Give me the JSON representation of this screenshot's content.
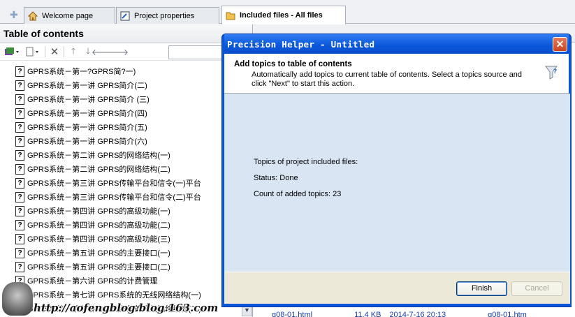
{
  "tabs": [
    {
      "label": "Welcome page",
      "icon": "home-icon"
    },
    {
      "label": "Project properties",
      "icon": "properties-icon"
    },
    {
      "label": "Included files - All files",
      "icon": "folder-icon"
    }
  ],
  "left_pane": {
    "title": "Table of contents",
    "toolbar_icons": [
      "add-topic-icon",
      "page-icon",
      "delete-icon",
      "move-up-icon",
      "move-down-icon",
      "move-left-icon",
      "move-right-icon"
    ],
    "items": [
      "GPRS系统－第一?GPRS简?一)",
      "GPRS系统－第一讲 GPRS简介(二)",
      "GPRS系统－第一讲 GPRS简介 (三)",
      "GPRS系统－第一讲 GPRS简介(四)",
      "GPRS系统－第一讲 GPRS简介(五)",
      "GPRS系统－第一讲 GPRS简介(六)",
      "GPRS系统－第二讲 GPRS的网络结构(一)",
      "GPRS系统－第二讲 GPRS的网络结构(二)",
      "GPRS系统－第三讲 GPRS传输平台和信令(一)平台",
      "GPRS系统－第三讲 GPRS传输平台和信令(二)平台",
      "GPRS系统－第四讲 GPRS的高级功能(一)",
      "GPRS系统－第四讲 GPRS的高级功能(二)",
      "GPRS系统－第四讲 GPRS的高级功能(三)",
      "GPRS系统－第五讲 GPRS的主要接口(一)",
      "GPRS系统－第五讲 GPRS的主要接口(二)",
      "GPRS系统－第六讲 GPRS的计费管理",
      "GPRS系统－第七讲 GPRS系统的无线网络结构(一)",
      "GPRS系统－第七讲 GPRS系统的无线网络结构(二)"
    ]
  },
  "right_pane": {
    "file_row": {
      "name": "g08-01.html",
      "size": "11.4 KB",
      "date": "2014-7-16 20:13",
      "name2": "g08-01.htm"
    }
  },
  "dialog": {
    "title": "Precision Helper - Untitled",
    "header_title": "Add topics to table of contents",
    "header_text": "Automatically add topics to current table of contents. Select a topics source and click \"Next\" to start this action.",
    "line1": "Topics of project included files:",
    "line2": "Status: Done",
    "line3": "Count of added topics: 23",
    "finish_label": "Finish",
    "cancel_label": "Cancel"
  },
  "watermark": "http://aofengblog.blog.163.com"
}
